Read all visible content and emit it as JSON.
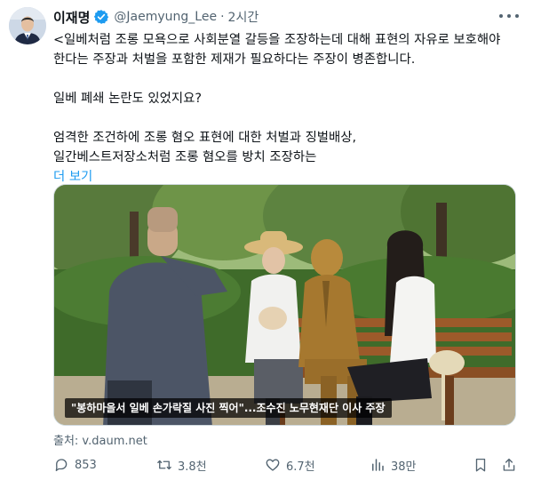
{
  "author": {
    "name": "이재명",
    "handle": "@Jaemyung_Lee",
    "separator": "·",
    "time": "2시간"
  },
  "tweet": {
    "lines": [
      "<일베처럼 조롱 모욕으로 사회분열 갈등을 조장하는데 대해 표현의 자유로 보호해야",
      "한다는 주장과 처벌을 포함한 제재가 필요하다는 주장이 병존합니다.",
      "일베 폐쇄 논란도 있었지요?",
      "엄격한 조건하에 조롱 혐오 표현에 대한 처벌과 징벌배상,",
      "일간베스트저장소처럼 조롱 혐오를 방치 조장하는"
    ],
    "show_more": "더 보기"
  },
  "media": {
    "caption": "\"봉하마을서 일베 손가락질 사진 찍어\"...조수진 노무현재단 이사 주장"
  },
  "source": "출처: v.daum.net",
  "actions": {
    "reply_count": "853",
    "retweet_count": "3.8천",
    "like_count": "6.7천",
    "view_count": "38만"
  },
  "icons": {
    "verified": "verified-badge-icon",
    "more": "more-options-icon",
    "reply": "reply-icon",
    "retweet": "retweet-icon",
    "like": "heart-icon",
    "views": "views-chart-icon",
    "bookmark": "bookmark-icon",
    "share": "share-icon"
  },
  "colors": {
    "accent": "#1d9bf0",
    "muted": "#536471",
    "text": "#0f1419"
  }
}
